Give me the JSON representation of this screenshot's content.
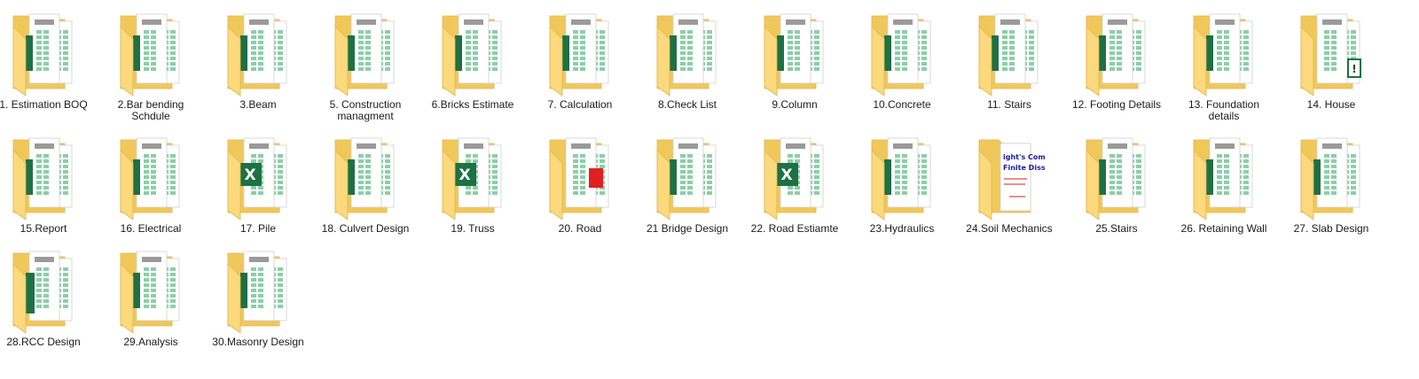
{
  "window": {
    "view": "large-icons"
  },
  "folders": [
    {
      "label": "1. Estimation BOQ",
      "preview": "excel-sheets",
      "icon": "folder-icon"
    },
    {
      "label": "2.Bar bending Schdule",
      "preview": "excel-sheets",
      "icon": "folder-icon"
    },
    {
      "label": "3.Beam",
      "preview": "excel-sheets",
      "icon": "folder-icon"
    },
    {
      "label": "5. Construction managment",
      "preview": "excel-sheets",
      "icon": "folder-icon"
    },
    {
      "label": "6.Bricks Estimate",
      "preview": "excel-sheets",
      "icon": "folder-icon"
    },
    {
      "label": "7. Calculation",
      "preview": "excel-sheets",
      "icon": "folder-icon"
    },
    {
      "label": "8.Check List",
      "preview": "excel-sheets",
      "icon": "folder-icon"
    },
    {
      "label": "9.Column",
      "preview": "excel-sheets",
      "icon": "folder-icon"
    },
    {
      "label": "10.Concrete",
      "preview": "excel-sheets",
      "icon": "folder-icon"
    },
    {
      "label": "11. Stairs",
      "preview": "excel-sheets",
      "icon": "folder-icon"
    },
    {
      "label": "12. Footing Details",
      "preview": "excel-sheets",
      "icon": "folder-icon"
    },
    {
      "label": "13. Foundation details",
      "preview": "excel-sheets",
      "icon": "folder-icon"
    },
    {
      "label": "14. House",
      "preview": "excel-warning",
      "icon": "folder-icon"
    },
    {
      "label": "15.Report",
      "preview": "excel-sheets",
      "icon": "folder-icon"
    },
    {
      "label": "16. Electrical",
      "preview": "excel-sheets",
      "icon": "folder-icon"
    },
    {
      "label": "17. Pile",
      "preview": "excel-logo",
      "icon": "folder-icon"
    },
    {
      "label": "18. Culvert Design",
      "preview": "excel-sheets",
      "icon": "folder-icon"
    },
    {
      "label": "19. Truss",
      "preview": "excel-logo",
      "icon": "folder-icon"
    },
    {
      "label": "20. Road",
      "preview": "excel-red",
      "icon": "folder-icon"
    },
    {
      "label": "21 Bridge Design",
      "preview": "excel-sheets",
      "icon": "folder-icon"
    },
    {
      "label": "22. Road Estiamte",
      "preview": "excel-logo",
      "icon": "folder-icon"
    },
    {
      "label": "23.Hydraulics",
      "preview": "excel-sheets",
      "icon": "folder-icon"
    },
    {
      "label": "24.Soil Mechanics",
      "preview": "document",
      "icon": "folder-icon"
    },
    {
      "label": "25.Stairs",
      "preview": "excel-sheets",
      "icon": "folder-icon"
    },
    {
      "label": "26. Retaining Wall",
      "preview": "excel-sheets",
      "icon": "folder-icon"
    },
    {
      "label": "27. Slab Design",
      "preview": "excel-sheets",
      "icon": "folder-icon"
    },
    {
      "label": "28.RCC Design",
      "preview": "excel-table",
      "icon": "folder-icon"
    },
    {
      "label": "29.Analysis",
      "preview": "excel-sheets",
      "icon": "folder-icon"
    },
    {
      "label": "30.Masonry Design",
      "preview": "excel-sheets",
      "icon": "folder-icon"
    }
  ],
  "colors": {
    "folder_back": "#f0c85a",
    "folder_front": "#fbd97c",
    "folder_edge": "#e1b54a",
    "excel_green": "#1e7145",
    "cell_green": "#8ccfa8",
    "cell_gray": "#9a9a9a",
    "accent_red": "#e02020"
  }
}
